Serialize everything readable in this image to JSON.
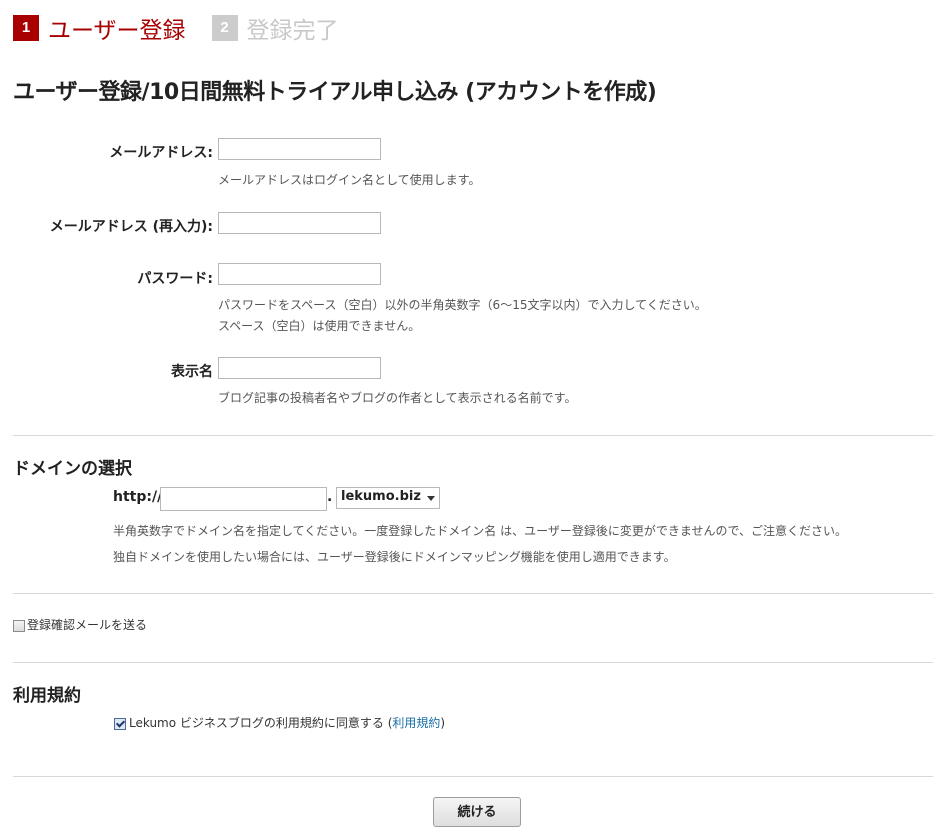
{
  "steps": [
    {
      "number": "1",
      "label": "ユーザー登録"
    },
    {
      "number": "2",
      "label": "登録完了"
    }
  ],
  "page_title": "ユーザー登録/10日間無料トライアル申し込み (アカウントを作成)",
  "fields": {
    "email": {
      "label": "メールアドレス:",
      "value": "",
      "help": "メールアドレスはログイン名として使用します。"
    },
    "email_confirm": {
      "label": "メールアドレス (再入力):",
      "value": ""
    },
    "password": {
      "label": "パスワード:",
      "value": "",
      "help_line1": "パスワードをスペース（空白）以外の半角英数字（6～15文字以内）で入力してください。",
      "help_line2": "スペース（空白）は使用できません。"
    },
    "display_name": {
      "label": "表示名",
      "value": "",
      "help": "ブログ記事の投稿者名やブログの作者として表示される名前です。"
    }
  },
  "domain": {
    "section_title": "ドメインの選択",
    "prefix": "http://",
    "value": "",
    "separator": ".",
    "selected_domain": "lekumo.biz",
    "help_line1": "半角英数字でドメイン名を指定してください。一度登録したドメイン名 は、ユーザー登録後に変更ができませんので、ご注意ください。",
    "help_line2": "独自ドメインを使用したい場合には、ユーザー登録後にドメインマッピング機能を使用し適用できます。"
  },
  "confirm_email": {
    "label": "登録確認メールを送る",
    "checked": false
  },
  "terms": {
    "section_title": "利用規約",
    "agree_text": "Lekumo ビジネスブログの利用規約に同意する (",
    "link_text": "利用規約",
    "close_paren": ")",
    "checked": true
  },
  "continue_label": "続ける",
  "colors": {
    "step_active": "#a80000",
    "step_inactive": "#cccccc",
    "link": "#1a6fa8"
  }
}
